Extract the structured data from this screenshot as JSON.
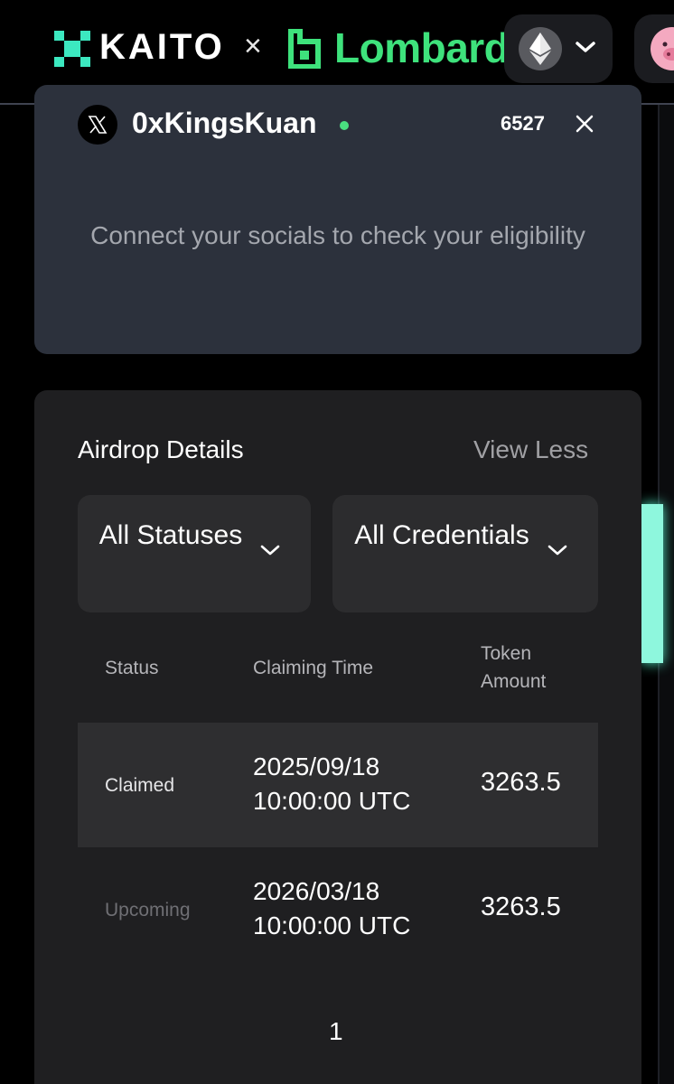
{
  "header": {
    "brand": "KAITO",
    "separator": "×",
    "partner": "Lombard",
    "brand_color": "#3ce8c0",
    "partner_color": "#3ee27c",
    "chain_icon": "ethereum-icon",
    "avatar_icon": "pig-avatar"
  },
  "social": {
    "platform_icon": "x-icon",
    "username": "0xKingsKuan",
    "status_color": "#4ade80",
    "score": "6527",
    "message": "Connect your socials to check your eligibility"
  },
  "airdrop": {
    "title": "Airdrop Details",
    "toggle_label": "View Less",
    "filters": [
      {
        "label": "All Statuses"
      },
      {
        "label": "All Credentials"
      }
    ],
    "columns": {
      "status": "Status",
      "time": "Claiming Time",
      "amount": "Token Amount"
    },
    "rows": [
      {
        "status": "Claimed",
        "date": "2025/09/18",
        "time": "10:00:00 UTC",
        "amount": "3263.5"
      },
      {
        "status": "Upcoming",
        "date": "2026/03/18",
        "time": "10:00:00 UTC",
        "amount": "3263.5"
      }
    ],
    "page": "1"
  }
}
